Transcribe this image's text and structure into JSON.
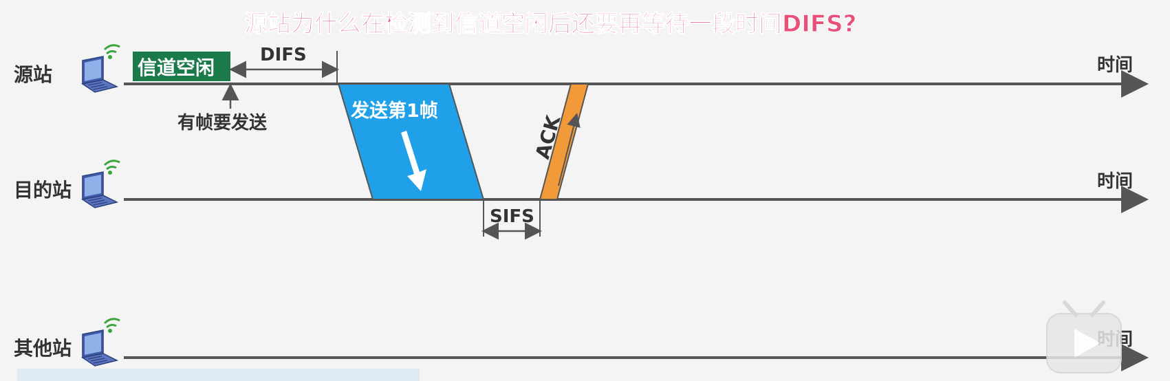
{
  "title": "源站为什么在检测到信道空闲后还要再等待一段时间DIFS?",
  "stations": {
    "source": "源站",
    "destination": "目的站",
    "other": "其他站"
  },
  "time_axis_label": "时间",
  "channel_idle_label": "信道空闲",
  "has_frame_label": "有帧要发送",
  "difs_label": "DIFS",
  "sifs_label": "SIFS",
  "frame_label": "发送第1帧",
  "ack_label": "ACK",
  "colors": {
    "title": "#e8507a",
    "idle_box": "#1b7a4a",
    "frame": "#1fa0e8",
    "ack": "#f29a3a",
    "axis": "#555555",
    "laptop": "#3f5aa8",
    "wifi": "#3aa53a"
  },
  "icons": [
    "laptop-wifi-icon",
    "play-button-icon"
  ]
}
